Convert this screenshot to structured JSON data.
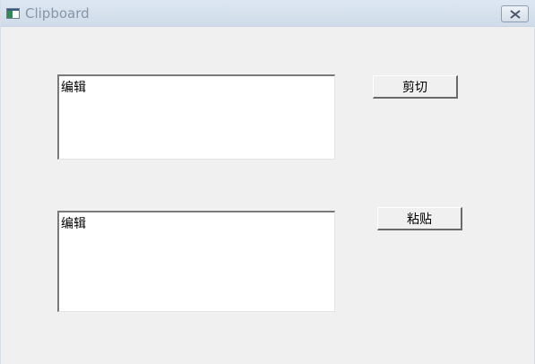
{
  "window": {
    "title": "Clipboard",
    "icon": "app-window-icon",
    "close_icon": "close-x-icon"
  },
  "top_edit": {
    "value": "编辑"
  },
  "bottom_edit": {
    "value": "编辑"
  },
  "buttons": {
    "cut_label": "剪切",
    "paste_label": "粘贴"
  }
}
